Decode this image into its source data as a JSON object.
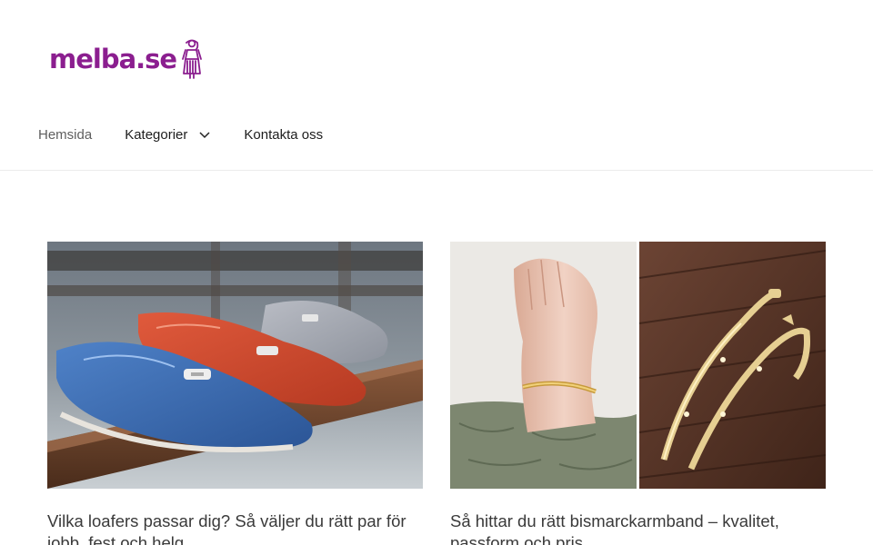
{
  "site": {
    "logo_text": "melba.se",
    "brand_color": "#8b1e8f"
  },
  "nav": {
    "items": [
      {
        "label": "Hemsida",
        "icon": null
      },
      {
        "label": "Kategorier",
        "icon": "chevron-down-icon"
      },
      {
        "label": "Kontakta oss",
        "icon": null
      }
    ]
  },
  "posts": [
    {
      "title": "Vilka loafers passar dig? Så väljer du rätt par för jobb, fest och helg",
      "image": "loafers-photo"
    },
    {
      "title": "Så hittar du rätt bismarckarmband – kvalitet, passform och pris",
      "image": "bracelet-photo"
    }
  ]
}
